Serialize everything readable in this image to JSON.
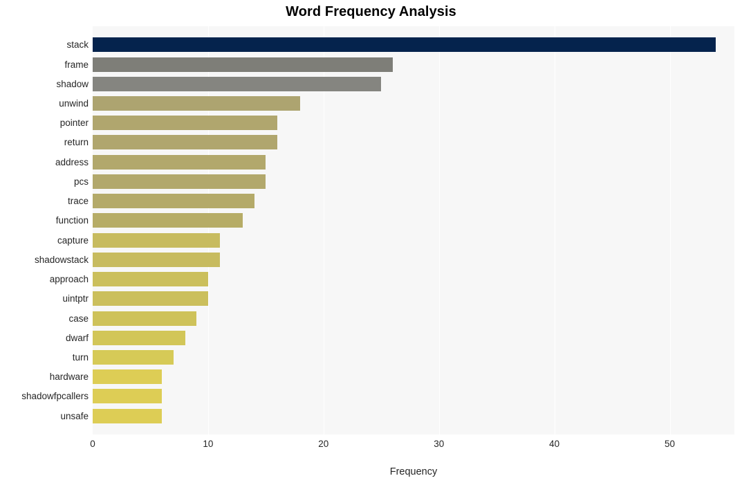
{
  "chart_data": {
    "type": "bar",
    "orientation": "horizontal",
    "title": "Word Frequency Analysis",
    "xlabel": "Frequency",
    "ylabel": "",
    "categories": [
      "stack",
      "frame",
      "shadow",
      "unwind",
      "pointer",
      "return",
      "address",
      "pcs",
      "trace",
      "function",
      "capture",
      "shadowstack",
      "approach",
      "uintptr",
      "case",
      "dwarf",
      "turn",
      "hardware",
      "shadowfpcallers",
      "unsafe"
    ],
    "values": [
      54,
      26,
      25,
      18,
      16,
      16,
      15,
      15,
      14,
      13,
      11,
      11,
      10,
      10,
      9,
      8,
      7,
      6,
      6,
      6
    ],
    "bar_colors": [
      "#05234d",
      "#7e7e78",
      "#858580",
      "#ada470",
      "#b0a66e",
      "#b0a66e",
      "#b2a86c",
      "#b2a86c",
      "#b4aa69",
      "#b6ac66",
      "#c7bb5f",
      "#c7bb5f",
      "#cbbf5c",
      "#cbbf5c",
      "#cec25a",
      "#d2c658",
      "#d6ca57",
      "#ddcd55",
      "#ddcd55",
      "#ddcd55"
    ],
    "xticks": [
      0,
      10,
      20,
      30,
      40,
      50
    ],
    "xlim": [
      0,
      55.6
    ],
    "grid": true,
    "grid_axis": "x",
    "legend": "none",
    "plot_background": "#f7f7f7",
    "figure_background": "#ffffff",
    "gridline_color": "#ffffff"
  }
}
